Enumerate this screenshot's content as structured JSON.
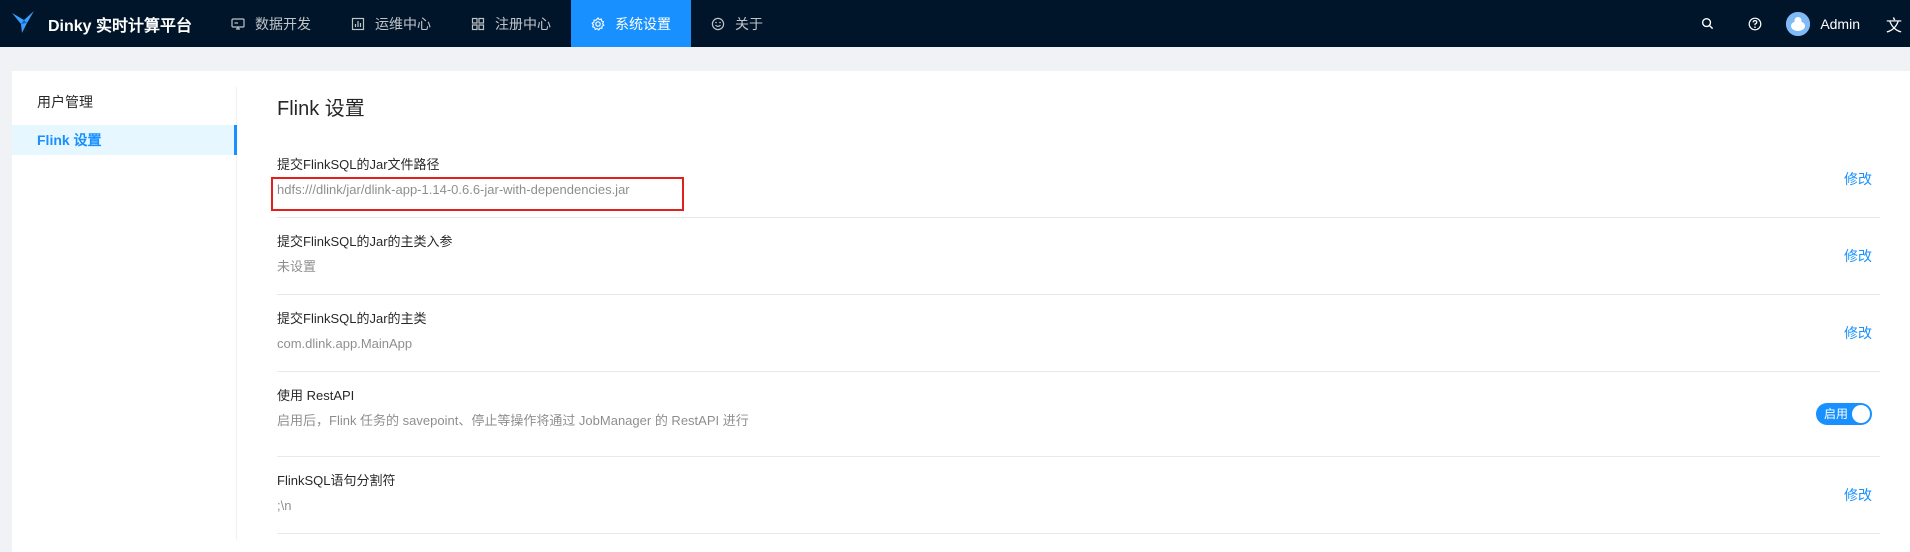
{
  "app": {
    "title": "Dinky 实时计算平台"
  },
  "nav": {
    "items": [
      {
        "label": "数据开发",
        "icon": "desktop-icon"
      },
      {
        "label": "运维中心",
        "icon": "chart-box-icon"
      },
      {
        "label": "注册中心",
        "icon": "appstore-icon"
      },
      {
        "label": "系统设置",
        "icon": "gear-icon",
        "active": true
      },
      {
        "label": "关于",
        "icon": "smile-icon"
      }
    ]
  },
  "user": {
    "name": "Admin"
  },
  "lang_glyph": "文",
  "sidebar": {
    "items": [
      {
        "label": "用户管理"
      },
      {
        "label": "Flink 设置",
        "active": true
      }
    ]
  },
  "main": {
    "title": "Flink 设置",
    "settings": [
      {
        "title": "提交FlinkSQL的Jar文件路径",
        "value": "hdfs:///dlink/jar/dlink-app-1.14-0.6.6-jar-with-dependencies.jar",
        "action": "修改"
      },
      {
        "title": "提交FlinkSQL的Jar的主类入参",
        "value": "未设置",
        "action": "修改"
      },
      {
        "title": "提交FlinkSQL的Jar的主类",
        "value": "com.dlink.app.MainApp",
        "action": "修改"
      },
      {
        "title": "使用 RestAPI",
        "value": "启用后，Flink 任务的 savepoint、停止等操作将通过 JobManager 的 RestAPI 进行",
        "toggle_label": "启用",
        "toggle_on": true
      },
      {
        "title": "FlinkSQL语句分割符",
        "value": ";\\n",
        "action": "修改"
      }
    ]
  },
  "colors": {
    "header_bg": "#001529",
    "accent": "#1890ff",
    "highlight_border": "#e0201a"
  }
}
